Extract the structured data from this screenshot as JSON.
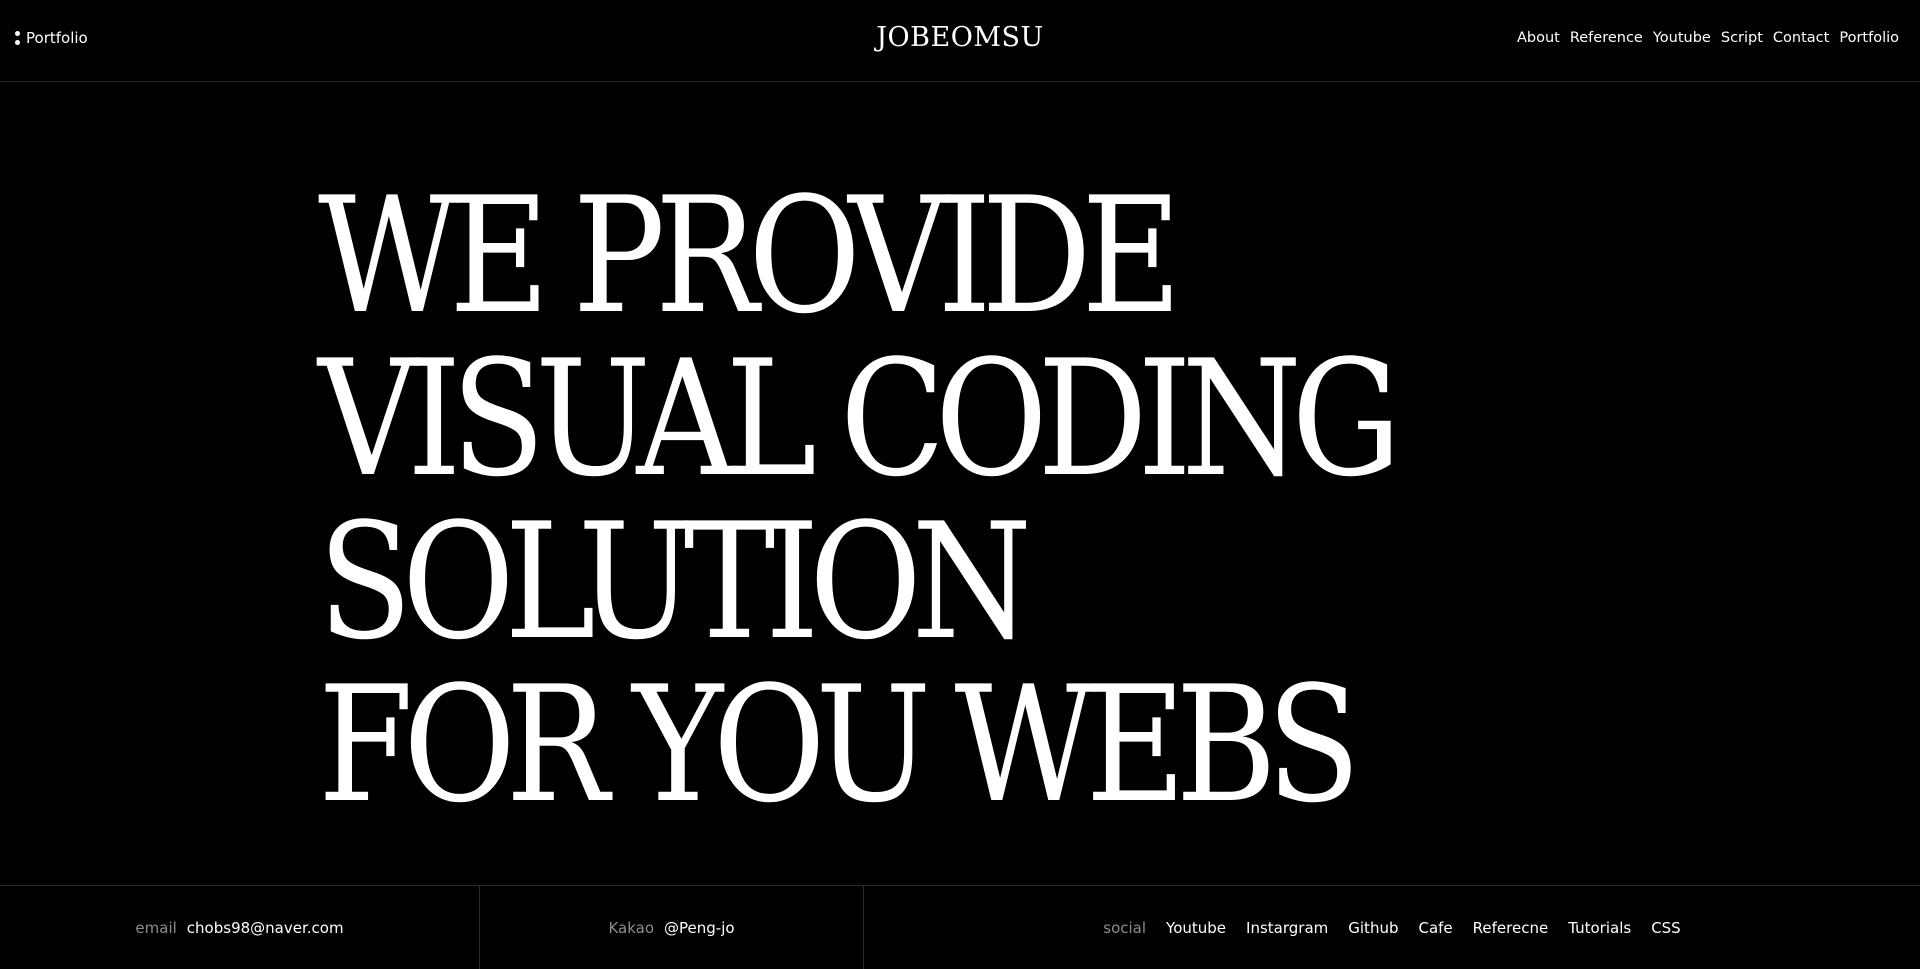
{
  "header": {
    "menu_label": "Portfolio",
    "logo": "JOBEOMSU",
    "nav": [
      "About",
      "Reference",
      "Youtube",
      "Script",
      "Contact",
      "Portfolio"
    ]
  },
  "hero": {
    "lines": [
      "WE PROVIDE",
      "VISUAL CODING",
      "SOLUTION",
      "FOR YOU WEBS"
    ]
  },
  "footer": {
    "email": {
      "label": "email",
      "value": "chobs98@naver.com"
    },
    "kakao": {
      "label": "Kakao",
      "value": "@Peng-jo"
    },
    "social": {
      "label": "social",
      "links": [
        "Youtube",
        "Instargram",
        "Github",
        "Cafe",
        "Referecne",
        "Tutorials",
        "CSS"
      ]
    }
  },
  "colors": {
    "background": "#000000",
    "text": "#ffffff",
    "muted": "#8c8c8c",
    "divider": "#2a2a2a"
  }
}
